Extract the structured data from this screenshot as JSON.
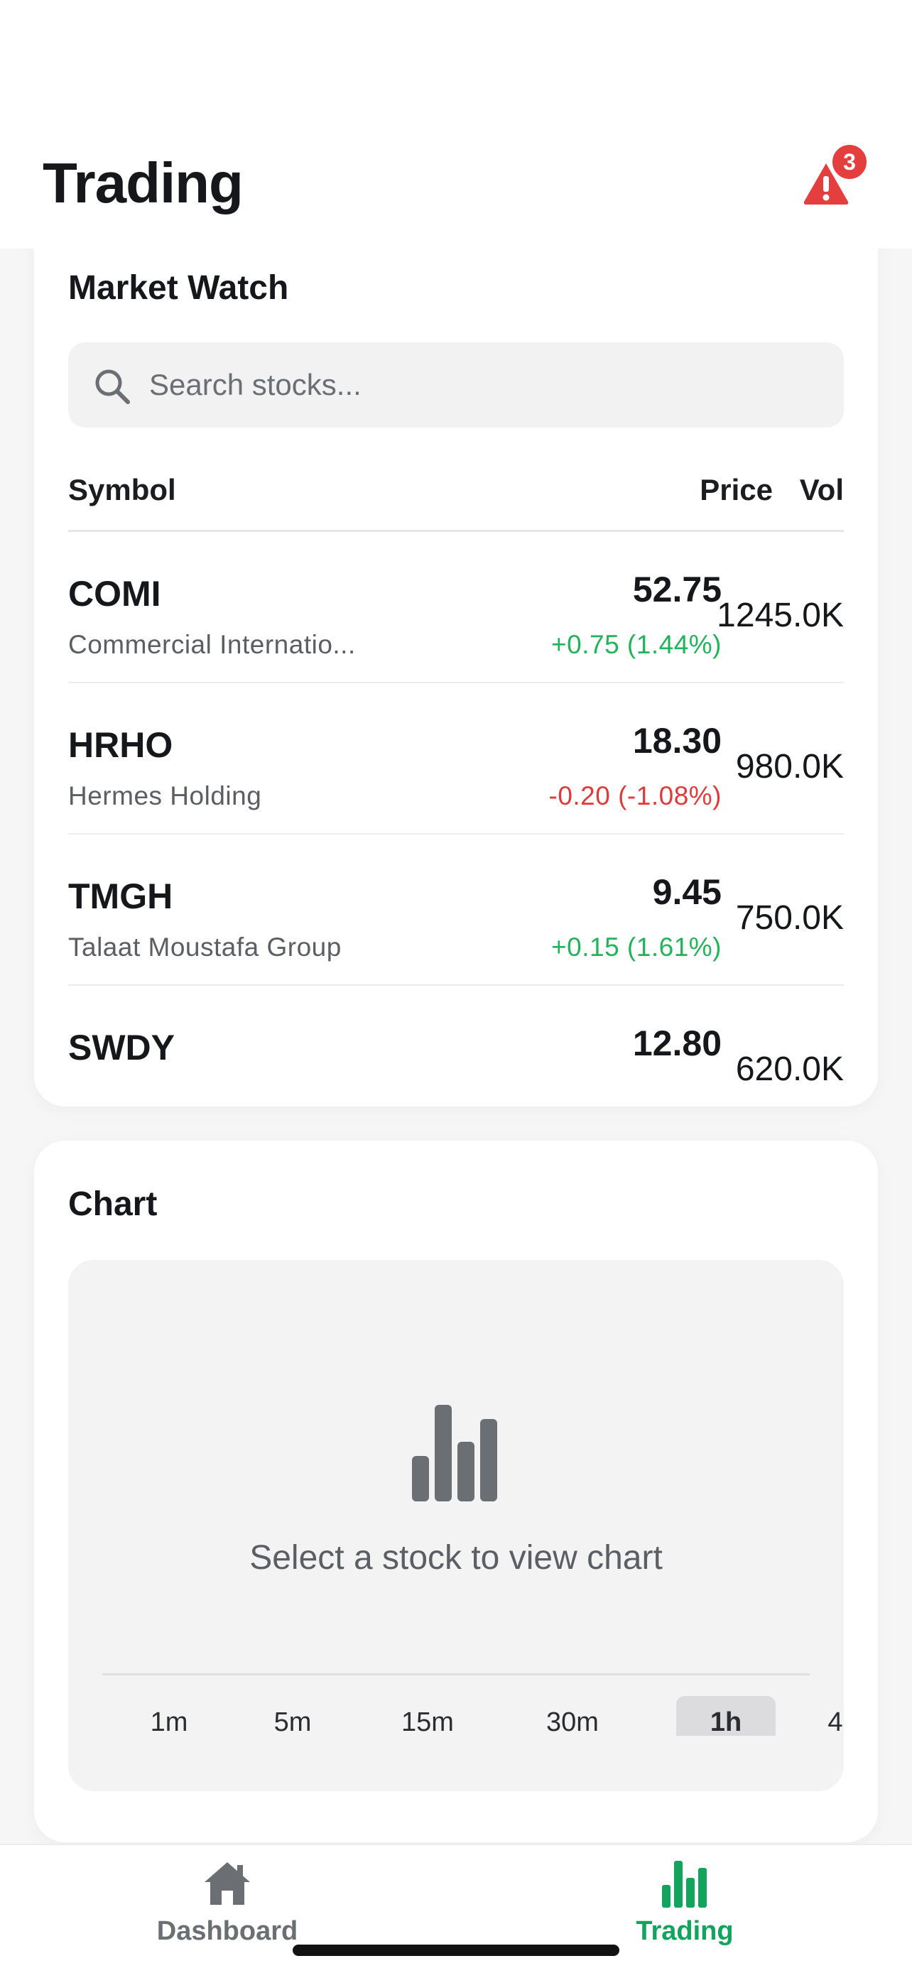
{
  "header": {
    "title": "Trading",
    "alert_count": "3"
  },
  "market": {
    "title": "Market Watch",
    "search_placeholder": "Search stocks...",
    "columns": {
      "symbol": "Symbol",
      "price": "Price",
      "vol": "Vol"
    },
    "rows": [
      {
        "symbol": "COMI",
        "name": "Commercial Internatio...",
        "price": "52.75",
        "change": "+0.75 (1.44%)",
        "direction": "up",
        "vol": "1245.0K"
      },
      {
        "symbol": "HRHO",
        "name": "Hermes Holding",
        "price": "18.30",
        "change": "-0.20 (-1.08%)",
        "direction": "down",
        "vol": "980.0K"
      },
      {
        "symbol": "TMGH",
        "name": "Talaat Moustafa Group",
        "price": "9.45",
        "change": "+0.15 (1.61%)",
        "direction": "up",
        "vol": "750.0K"
      },
      {
        "symbol": "SWDY",
        "name": "",
        "price": "12.80",
        "change": "",
        "direction": "",
        "vol": "620.0K"
      }
    ]
  },
  "chart": {
    "title": "Chart",
    "empty_message": "Select a stock to view chart",
    "timeframes": [
      "1m",
      "5m",
      "15m",
      "30m",
      "1h",
      "4"
    ],
    "active_timeframe": "1h"
  },
  "tabs": [
    {
      "label": "Dashboard",
      "icon": "home-icon",
      "active": false
    },
    {
      "label": "Trading",
      "icon": "bar-chart-icon",
      "active": true
    }
  ],
  "colors": {
    "up": "#22b35b",
    "down": "#e03b3b",
    "accent": "#12a35c",
    "alert": "#e53e3e"
  }
}
